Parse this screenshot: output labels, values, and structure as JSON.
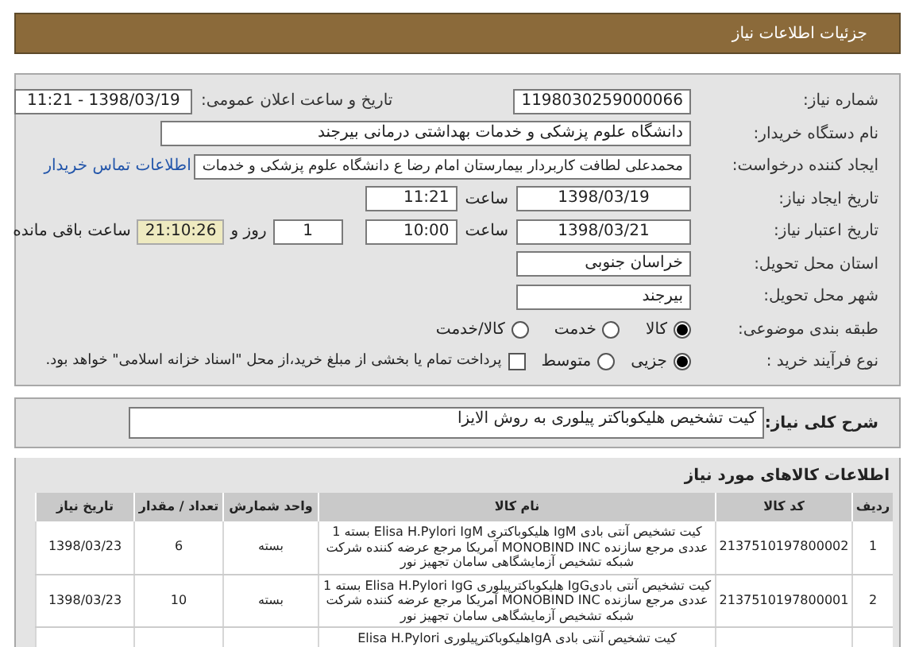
{
  "page_header": {
    "title": "جزئیات اطلاعات نیاز"
  },
  "need_number": {
    "label": "شماره نیاز:",
    "value": "1198030259000066"
  },
  "announce": {
    "label": "تاریخ و ساعت اعلان عمومی:",
    "value": "1398/03/19 - 11:21"
  },
  "buyer": {
    "label": "نام دستگاه خریدار:",
    "value": "دانشگاه علوم پزشکی و خدمات بهداشتی درمانی بیرجند"
  },
  "requester": {
    "label": "ایجاد کننده درخواست:",
    "value": "محمدعلی لطافت کاربردار بیمارستان امام رضا ع دانشگاه علوم پزشکی و خدمات",
    "contact_link": "اطلاعات تماس خریدار"
  },
  "created": {
    "label": "تاریخ ایجاد نیاز:",
    "date": "1398/03/19",
    "time_label": "ساعت",
    "time": "11:21"
  },
  "validity": {
    "label": "تاریخ اعتبار نیاز:",
    "date": "1398/03/21",
    "time_label": "ساعت",
    "time": "10:00",
    "days": "1",
    "days_label": "روز و",
    "remaining": "21:10:26",
    "remaining_label": "ساعت باقی مانده"
  },
  "province": {
    "label": "استان محل تحویل:",
    "value": "خراسان جنوبی"
  },
  "city": {
    "label": "شهر محل تحویل:",
    "value": "بیرجند"
  },
  "category": {
    "label": "طبقه بندی موضوعی:",
    "options": [
      {
        "label": "کالا",
        "selected": true
      },
      {
        "label": "خدمت",
        "selected": false
      },
      {
        "label": "کالا/خدمت",
        "selected": false
      }
    ]
  },
  "process": {
    "label": "نوع فرآیند خرید :",
    "options": [
      {
        "label": "جزیی",
        "selected": true
      },
      {
        "label": "متوسط",
        "selected": false
      }
    ],
    "treasury": {
      "label": "پرداخت تمام یا بخشی از مبلغ خرید،از محل \"اسناد خزانه اسلامی\" خواهد بود.",
      "checked": false
    }
  },
  "summary": {
    "label": "شرح کلی نیاز:",
    "value": "کیت تشخیص هلیکوباکتر پیلوری به روش الایزا"
  },
  "items": {
    "title": "اطلاعات کالاهای مورد نیاز",
    "columns": [
      "ردیف",
      "کد کالا",
      "نام کالا",
      "واحد شمارش",
      "تعداد / مقدار",
      "تاریخ نیاز"
    ],
    "rows": [
      {
        "index": "1",
        "code": "2137510197800002",
        "name": "کیت تشخیص آنتی بادی IgM هلیکوباکتری Elisa H.Pylori IgM بسته 1 عددی مرجع سازنده MONOBIND INC آمریکا مرجع عرضه کننده شرکت شبکه تشخیص آزمایشگاهی سامان تجهیز نور",
        "unit": "بسته",
        "qty": "6",
        "date": "1398/03/23"
      },
      {
        "index": "2",
        "code": "2137510197800001",
        "name": "کیت تشخیص آنتی بادیIgG هلیکوباکترپیلوری Elisa H.Pylori IgG بسته 1 عددی مرجع سازنده MONOBIND INC آمریکا مرجع عرضه کننده شرکت شبکه تشخیص آزمایشگاهی سامان تجهیز نور",
        "unit": "بسته",
        "qty": "10",
        "date": "1398/03/23"
      },
      {
        "name": "کیت تشخیص آنتی بادی IgAهلیکوباکترپیلوری Elisa H.Pylori"
      }
    ]
  }
}
